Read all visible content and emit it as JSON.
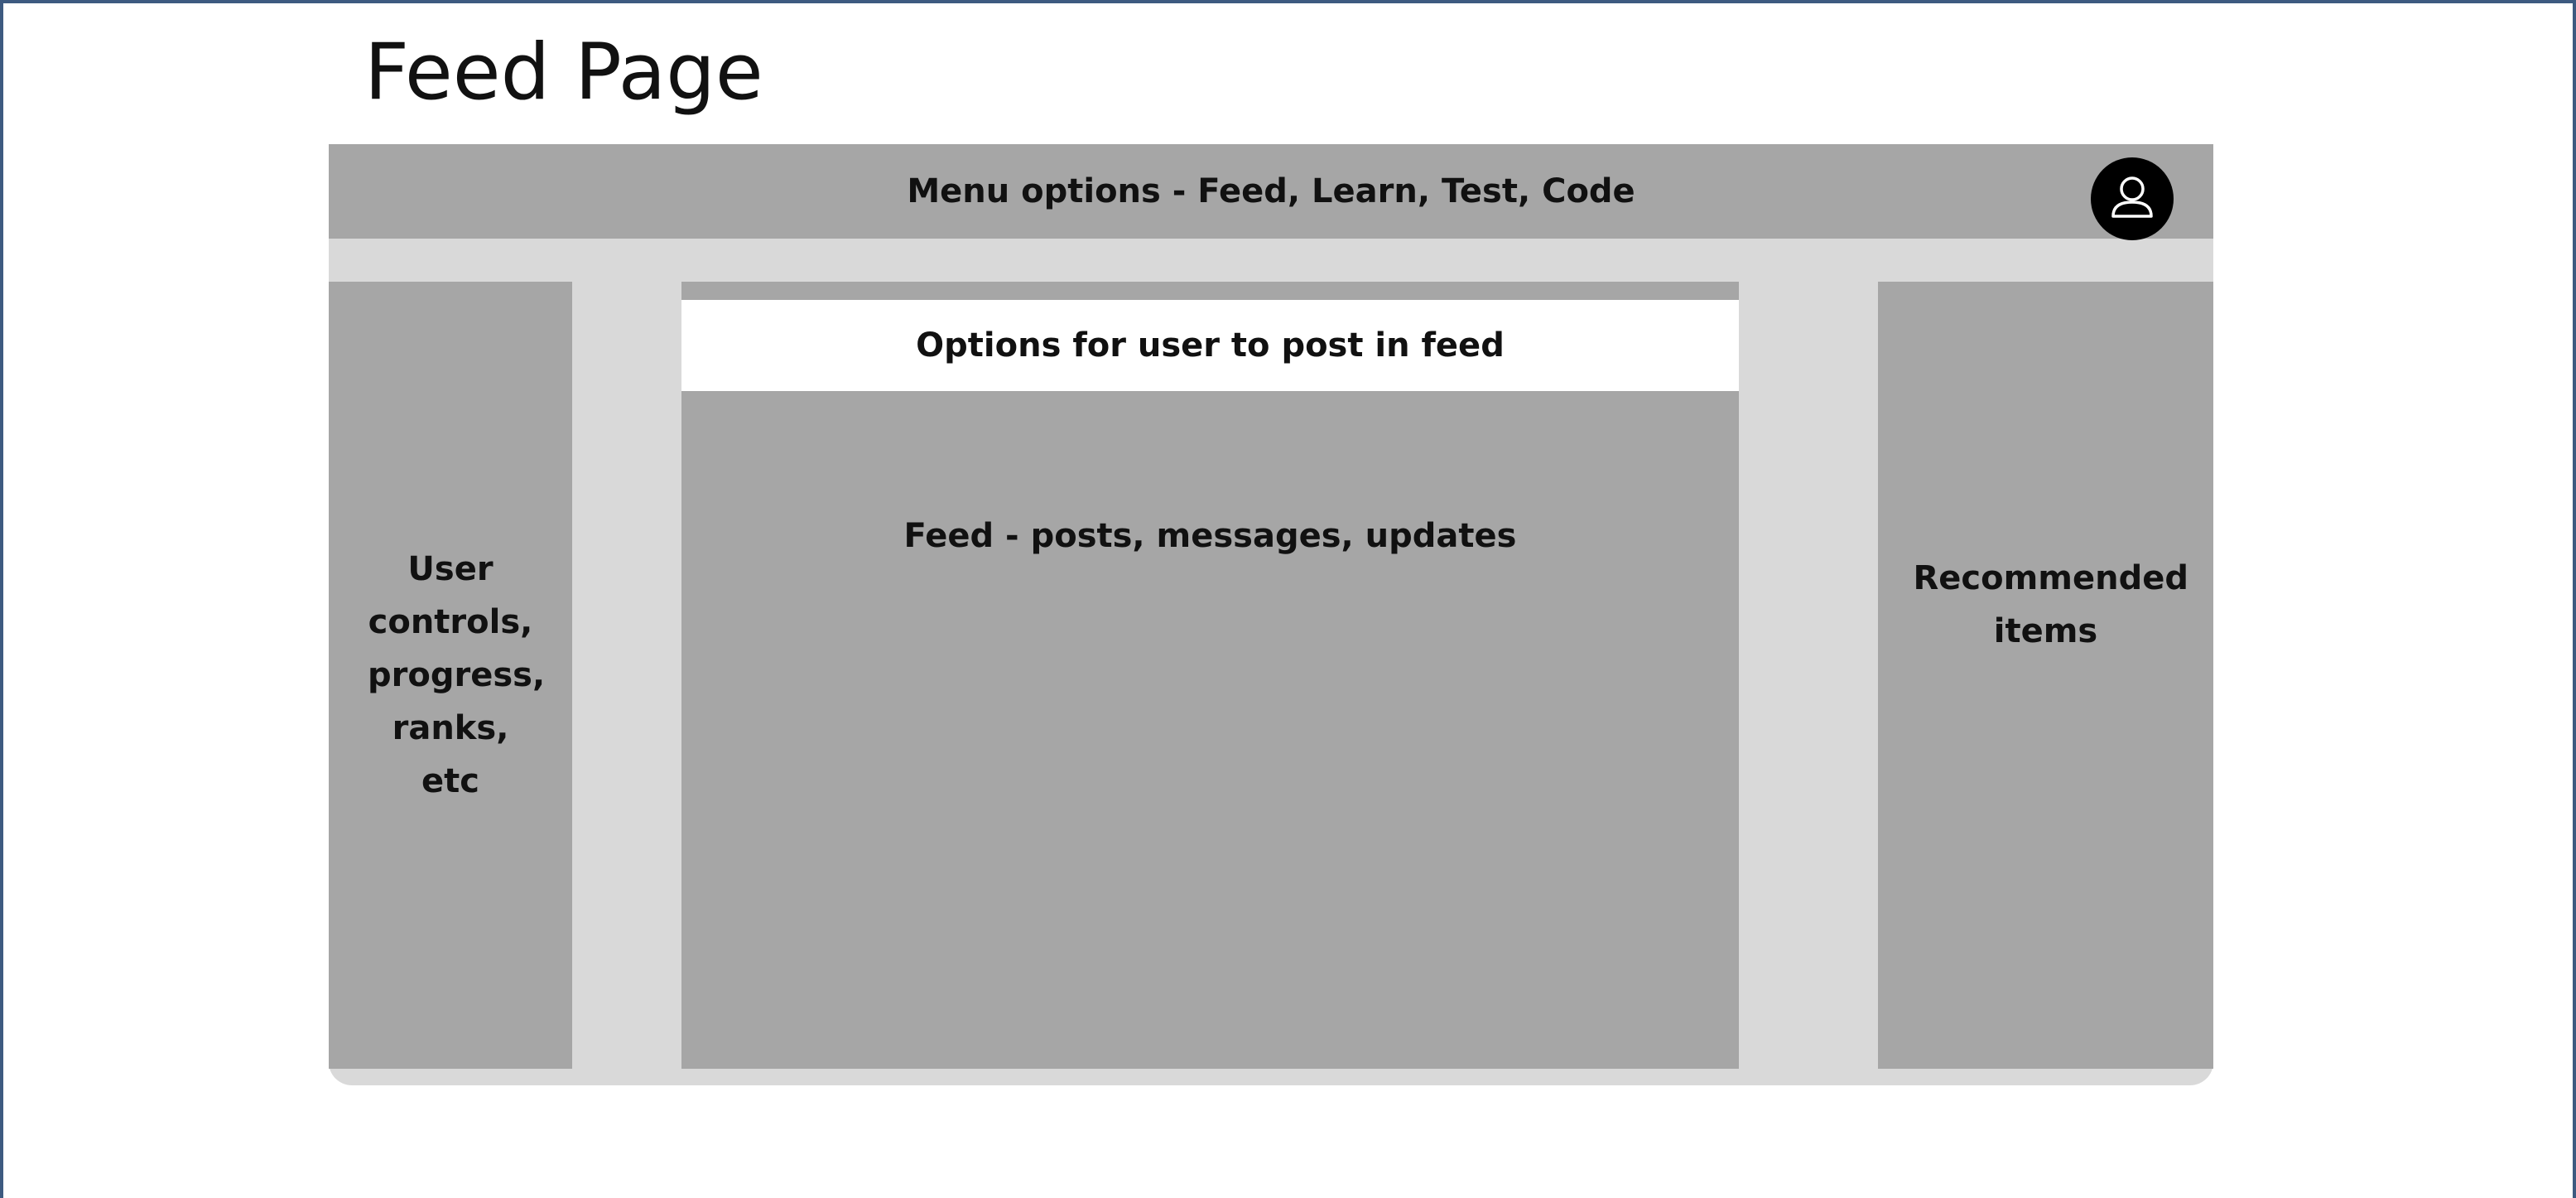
{
  "page": {
    "title": "Feed Page"
  },
  "menu": {
    "label": "Menu options - Feed, Learn, Test, Code",
    "avatar_icon": "user-avatar-icon"
  },
  "left_panel": {
    "label": "User controls, progress, ranks, etc"
  },
  "center_panel": {
    "post_options_label": "Options for user to post in feed",
    "feed_label": "Feed - posts, messages, updates"
  },
  "right_panel": {
    "label": "Recommended items"
  },
  "colors": {
    "frame_border": "#3d5a80",
    "panel_gray": "#a6a6a6",
    "background_light_gray": "#d9d9d9",
    "white": "#ffffff",
    "avatar_black": "#000000"
  }
}
